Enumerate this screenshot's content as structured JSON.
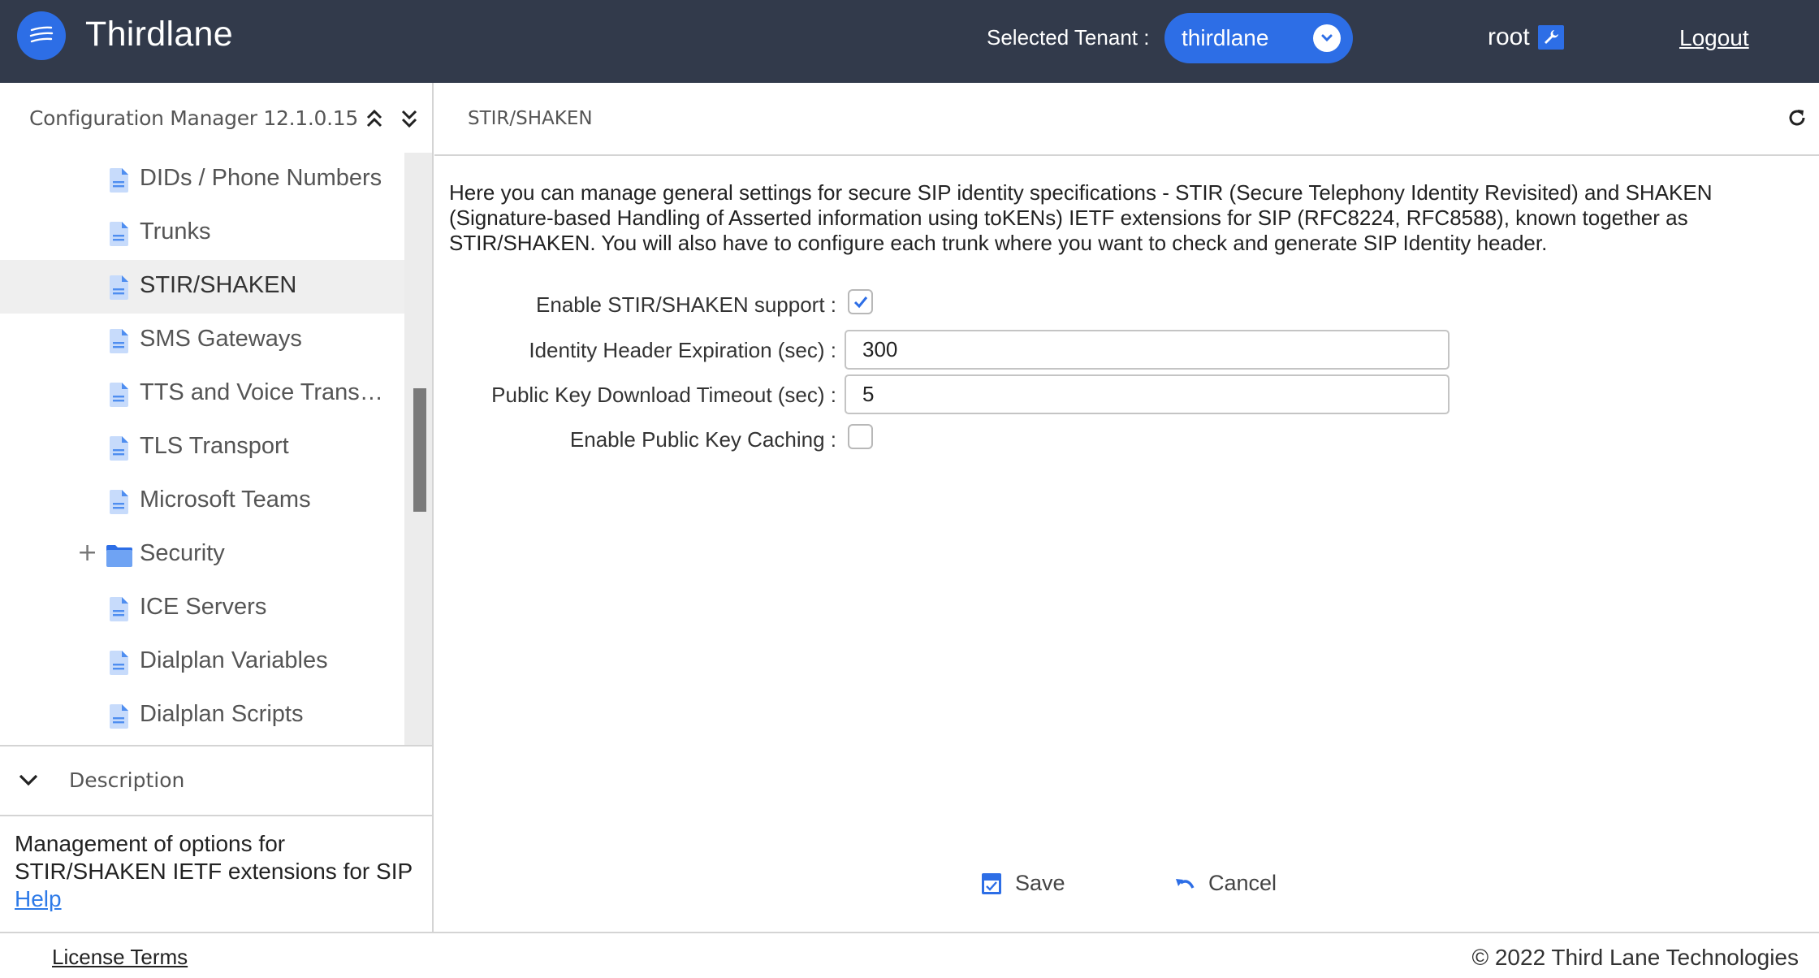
{
  "header": {
    "brand": "Thirdlane",
    "tenant_label": "Selected Tenant :",
    "tenant_value": "thirdlane",
    "user": "root",
    "logout": "Logout"
  },
  "sidebar": {
    "title": "Configuration Manager 12.1.0.15",
    "tree": [
      {
        "label": "DIDs / Phone Numbers",
        "type": "document",
        "selected": false
      },
      {
        "label": "Trunks",
        "type": "document",
        "selected": false
      },
      {
        "label": "STIR/SHAKEN",
        "type": "document",
        "selected": true
      },
      {
        "label": "SMS Gateways",
        "type": "document",
        "selected": false
      },
      {
        "label": "TTS and Voice Transcri...",
        "type": "document",
        "selected": false
      },
      {
        "label": "TLS Transport",
        "type": "document",
        "selected": false
      },
      {
        "label": "Microsoft Teams",
        "type": "document",
        "selected": false
      },
      {
        "label": "Security",
        "type": "folder",
        "selected": false,
        "expandable": true
      },
      {
        "label": "ICE Servers",
        "type": "document",
        "selected": false
      },
      {
        "label": "Dialplan Variables",
        "type": "document",
        "selected": false
      },
      {
        "label": "Dialplan Scripts",
        "type": "document",
        "selected": false
      }
    ],
    "description_title": "Description",
    "description_text": "Management of options for STIR/SHAKEN IETF extensions for SIP",
    "help_link": "Help"
  },
  "main": {
    "title": "STIR/SHAKEN",
    "intro": "Here you can manage general settings for secure SIP identity specifications - STIR (Secure Telephony Identity Revisited) and SHAKEN (Signature-based Handling of Asserted information using toKENs) IETF extensions for SIP (RFC8224, RFC8588), known together as STIR/SHAKEN. You will also have to configure each trunk where you want to check and generate SIP Identity header.",
    "form": {
      "enable_support_label": "Enable STIR/SHAKEN support :",
      "enable_support_checked": true,
      "expiration_label": "Identity Header Expiration (sec) :",
      "expiration_value": "300",
      "timeout_label": "Public Key Download Timeout (sec) :",
      "timeout_value": "5",
      "caching_label": "Enable Public Key Caching  :",
      "caching_checked": false
    },
    "save": "Save",
    "cancel": "Cancel"
  },
  "footer": {
    "license": "License Terms",
    "copyright": "© 2022 Third Lane Technologies"
  },
  "colors": {
    "header_bg": "#323a4b",
    "accent": "#2d6ee6",
    "selected_row": "#efefef"
  }
}
